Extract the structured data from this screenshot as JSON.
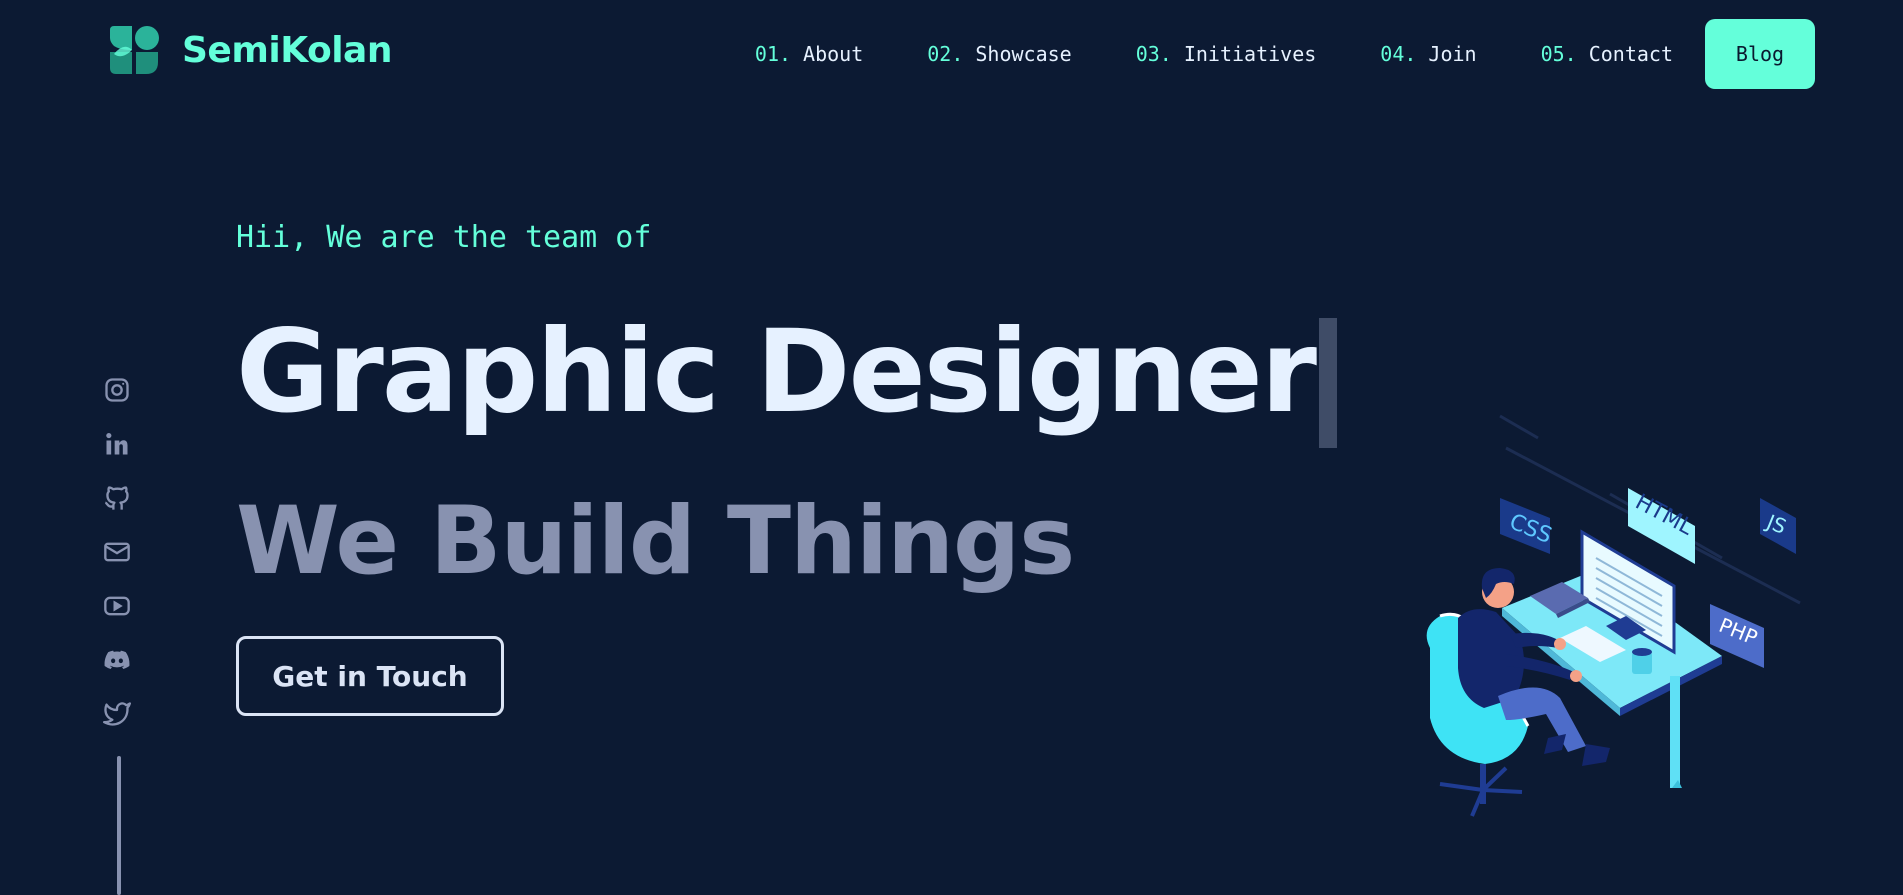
{
  "header": {
    "logo_text": "SemiKolan",
    "nav": [
      {
        "num": "01.",
        "label": "About"
      },
      {
        "num": "02.",
        "label": "Showcase"
      },
      {
        "num": "03.",
        "label": "Initiatives"
      },
      {
        "num": "04.",
        "label": "Join"
      },
      {
        "num": "05.",
        "label": "Contact"
      }
    ],
    "blog_label": "Blog"
  },
  "hero": {
    "greeting": "Hii, We are the team of",
    "headline": "Graphic Designer",
    "subline": "We Build Things",
    "cta_label": "Get in Touch"
  },
  "illustration": {
    "tags": [
      "CSS",
      "HTML",
      "JS",
      "PHP"
    ]
  },
  "social": [
    "instagram-icon",
    "linkedin-icon",
    "github-icon",
    "mail-icon",
    "youtube-icon",
    "discord-icon",
    "twitter-icon"
  ],
  "colors": {
    "background": "#0c1a33",
    "accent": "#64ffda",
    "text_light": "#e6f1ff",
    "text_muted": "#8892b0"
  }
}
